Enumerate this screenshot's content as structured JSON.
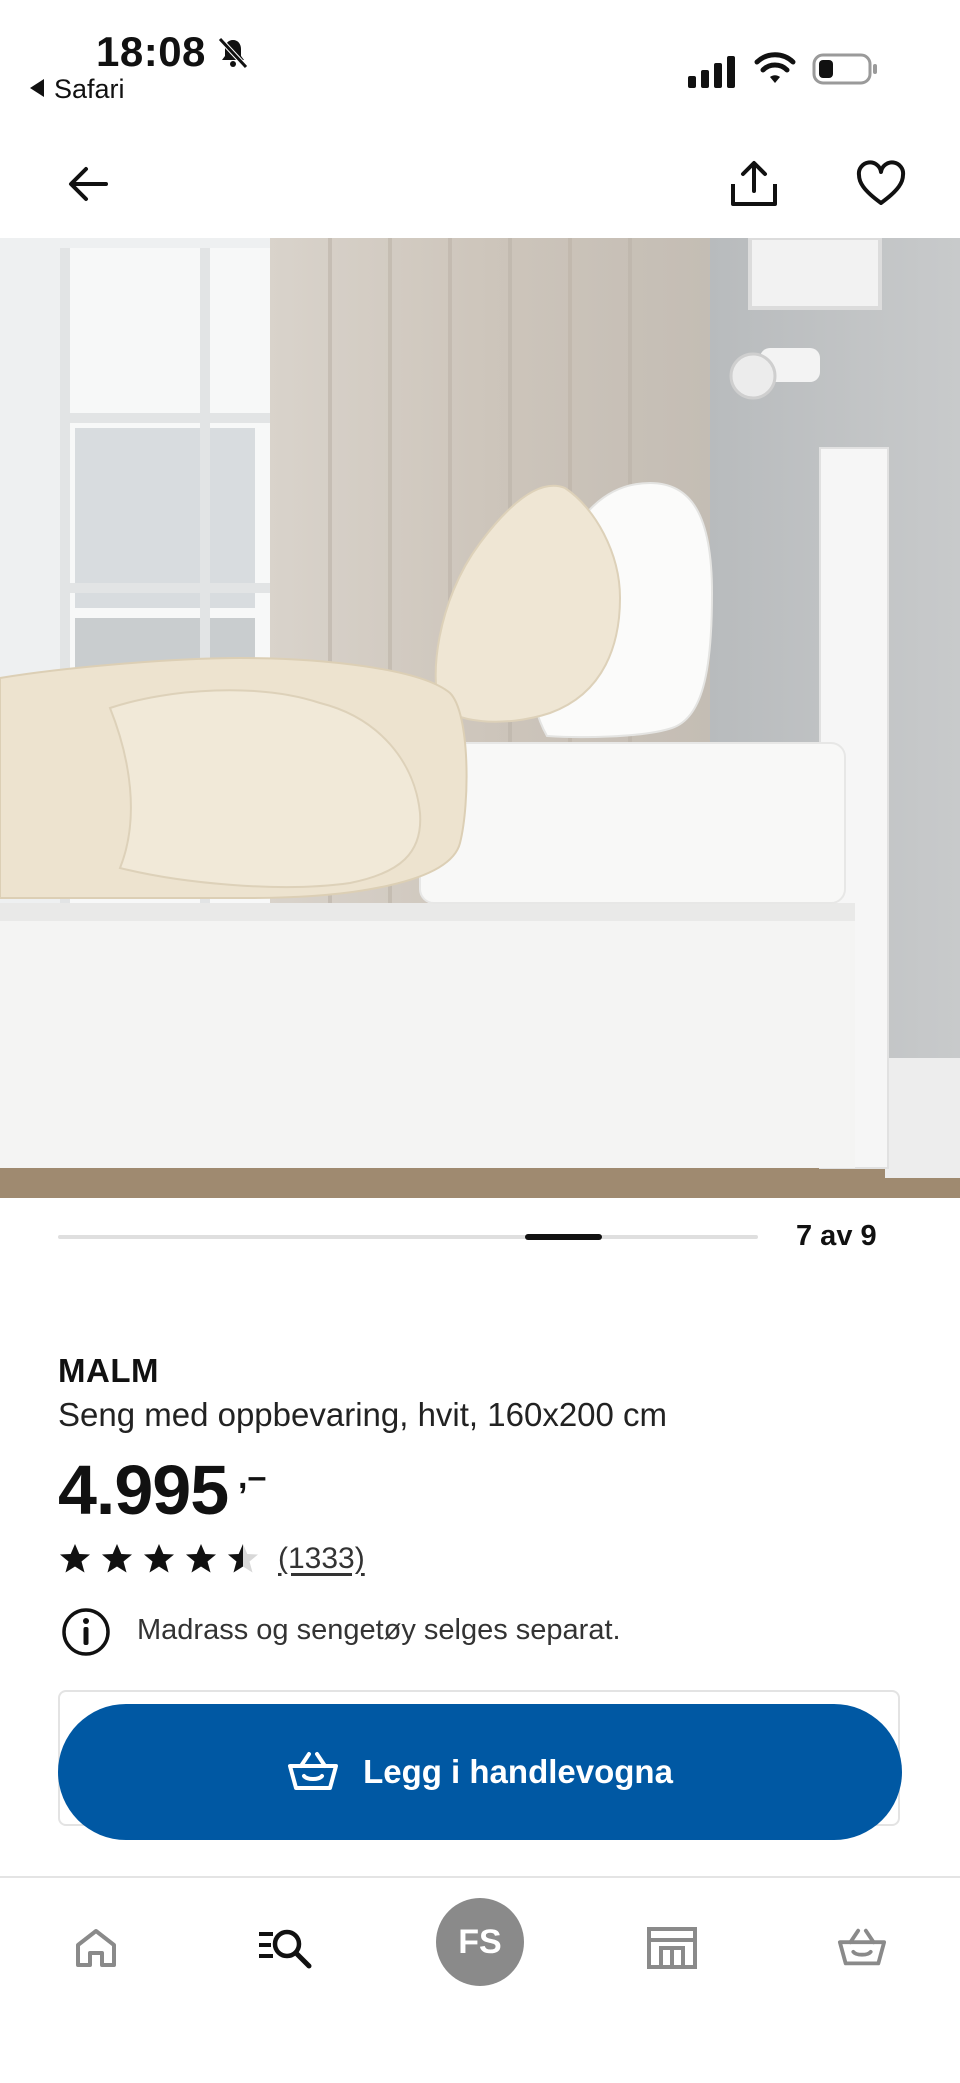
{
  "status_bar": {
    "time": "18:08",
    "back_app": "Safari"
  },
  "top_nav": {
    "back_icon": "arrow-left-icon",
    "share_icon": "share-icon",
    "favorite_icon": "heart-icon"
  },
  "gallery": {
    "image_description": "white bed with storage and beige bedding",
    "counter": "7 av 9",
    "current_index": 7,
    "total": 9
  },
  "product": {
    "name": "MALM",
    "description": "Seng med oppbevaring, hvit, 160x200 cm",
    "price": "4.995",
    "price_suffix": ",–",
    "rating_value": 4.5,
    "rating_max": 5,
    "reviews_count": "(1333)",
    "info_text": "Madrass og sengetøy selges separat.",
    "add_to_cart_label": "Legg i handlevogna"
  },
  "tab_bar": {
    "items": [
      {
        "name": "home",
        "icon": "home-icon"
      },
      {
        "name": "search",
        "icon": "search-icon"
      },
      {
        "name": "profile",
        "initials": "FS"
      },
      {
        "name": "stores",
        "icon": "store-icon"
      },
      {
        "name": "cart",
        "icon": "basket-icon"
      }
    ]
  },
  "colors": {
    "primary_blue": "#0058a3",
    "text": "#111111",
    "avatar_bg": "#8a8a8a"
  }
}
